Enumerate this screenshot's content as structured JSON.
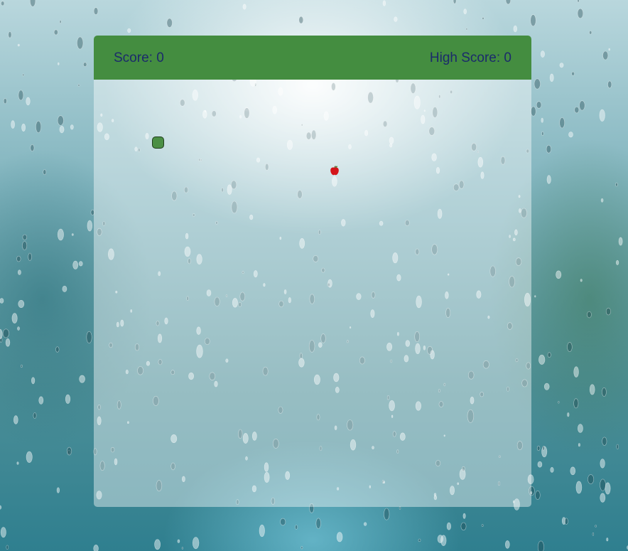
{
  "hud": {
    "score_label": "Score: 0",
    "high_score_label": "High Score: 0"
  },
  "game": {
    "snake_color": "#4b8f45",
    "food": "apple-icon",
    "header_color": "#448d40"
  }
}
